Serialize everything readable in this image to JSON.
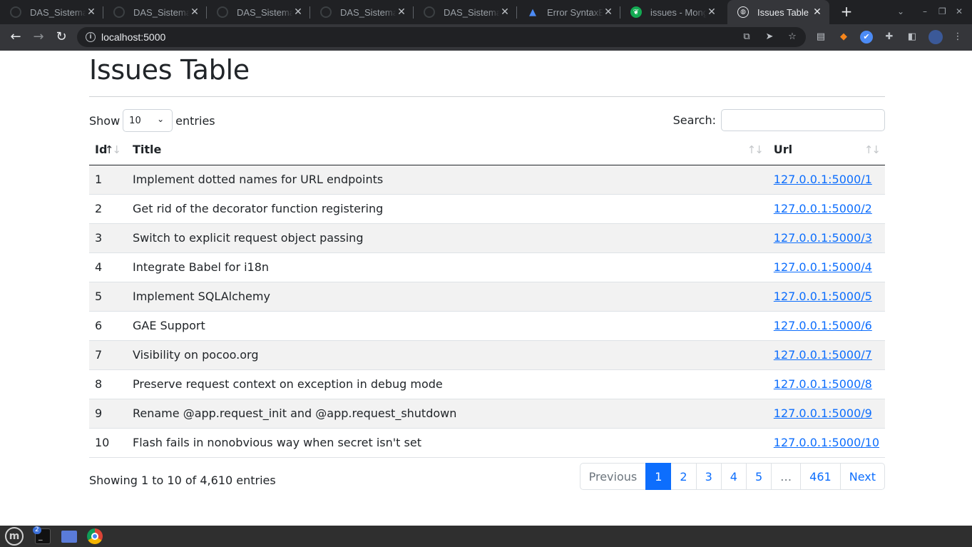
{
  "browser": {
    "tabs": [
      {
        "title": "DAS_Sistemas",
        "icon": "github-icon"
      },
      {
        "title": "DAS_Sistemas",
        "icon": "github-icon"
      },
      {
        "title": "DAS_Sistemas",
        "icon": "github-icon"
      },
      {
        "title": "DAS_Sistemas",
        "icon": "github-icon"
      },
      {
        "title": "DAS_Sistemas",
        "icon": "github-icon"
      },
      {
        "title": "Error SyntaxE",
        "icon": "atlassian-icon"
      },
      {
        "title": "issues - Mongo",
        "icon": "mongodb-icon"
      },
      {
        "title": "Issues Table",
        "icon": "globe-icon"
      }
    ],
    "address": "localhost:5000",
    "workspace_badge": "2"
  },
  "page": {
    "title": "Issues Table",
    "length_label_before": "Show",
    "length_value": "10",
    "length_label_after": "entries",
    "search_label": "Search:",
    "search_value": "",
    "columns": [
      "Id",
      "Title",
      "Url"
    ],
    "rows": [
      {
        "id": "1",
        "title": "Implement dotted names for URL endpoints",
        "url": "127.0.0.1:5000/1"
      },
      {
        "id": "2",
        "title": "Get rid of the decorator function registering",
        "url": "127.0.0.1:5000/2"
      },
      {
        "id": "3",
        "title": "Switch to explicit request object passing",
        "url": "127.0.0.1:5000/3"
      },
      {
        "id": "4",
        "title": "Integrate Babel for i18n",
        "url": "127.0.0.1:5000/4"
      },
      {
        "id": "5",
        "title": "Implement SQLAlchemy",
        "url": "127.0.0.1:5000/5"
      },
      {
        "id": "6",
        "title": "GAE Support",
        "url": "127.0.0.1:5000/6"
      },
      {
        "id": "7",
        "title": "Visibility on pocoo.org",
        "url": "127.0.0.1:5000/7"
      },
      {
        "id": "8",
        "title": "Preserve request context on exception in debug mode",
        "url": "127.0.0.1:5000/8"
      },
      {
        "id": "9",
        "title": "Rename @app.request_init and @app.request_shutdown",
        "url": "127.0.0.1:5000/9"
      },
      {
        "id": "10",
        "title": "Flash fails in nonobvious way when secret isn't set",
        "url": "127.0.0.1:5000/10"
      }
    ],
    "info": "Showing 1 to 10 of 4,610 entries",
    "pagination": {
      "previous": "Previous",
      "pages": [
        "1",
        "2",
        "3",
        "4",
        "5"
      ],
      "ellipsis": "…",
      "last_page": "461",
      "next": "Next"
    }
  },
  "colors": {
    "accent": "#0d6efd",
    "chrome_dark": "#202124",
    "chrome_toolbar": "#35363a"
  }
}
